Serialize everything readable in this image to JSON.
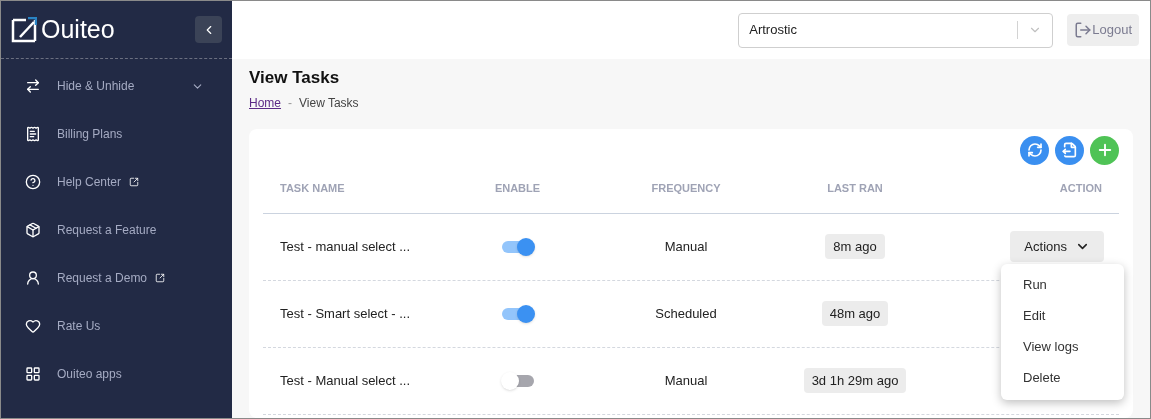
{
  "brand": {
    "name": "Ouiteo"
  },
  "sidebar": {
    "items": [
      {
        "label": "Hide & Unhide",
        "kind": "group",
        "expanded": false
      },
      {
        "label": "Billing Plans",
        "kind": "link"
      },
      {
        "label": "Help Center",
        "kind": "external"
      },
      {
        "label": "Request a Feature",
        "kind": "link"
      },
      {
        "label": "Request a Demo",
        "kind": "external"
      },
      {
        "label": "Rate Us",
        "kind": "link"
      },
      {
        "label": "Ouiteo apps",
        "kind": "link"
      }
    ]
  },
  "header": {
    "account_select": {
      "value": "Artrostic"
    },
    "logout": "Logout"
  },
  "page": {
    "title": "View Tasks",
    "breadcrumb_separator": "-",
    "breadcrumb": [
      {
        "label": "Home",
        "link": true
      },
      {
        "label": "View Tasks",
        "link": false
      }
    ]
  },
  "table": {
    "columns": [
      "TASK NAME",
      "ENABLE",
      "FREQUENCY",
      "LAST RAN",
      "ACTION"
    ],
    "rows": [
      {
        "name": "Test - manual select ...",
        "on": true,
        "frequency": "Manual",
        "last_ran": "8m ago",
        "action": "Actions"
      },
      {
        "name": "Test - Smart select - ...",
        "on": true,
        "frequency": "Scheduled",
        "last_ran": "48m ago"
      },
      {
        "name": "Test - Manual select ...",
        "on": false,
        "frequency": "Manual",
        "last_ran": "3d 1h 29m ago"
      }
    ]
  },
  "actions_menu": {
    "open": true,
    "items": [
      "Run",
      "Edit",
      "View logs",
      "Delete"
    ]
  }
}
